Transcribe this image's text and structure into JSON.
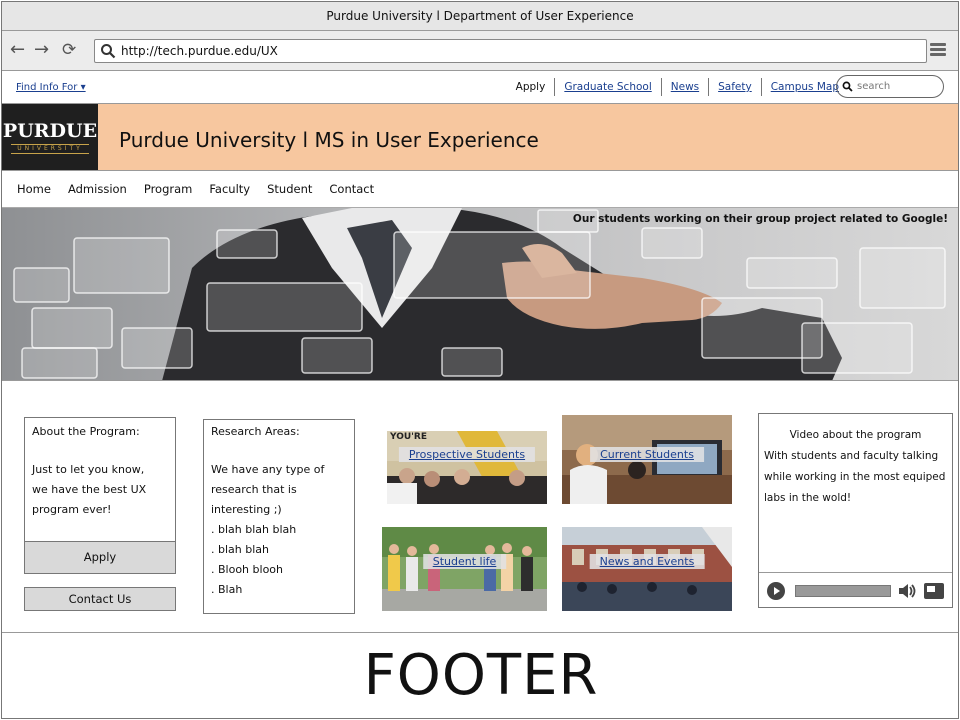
{
  "window": {
    "title": "Purdue University l Department of User Experience"
  },
  "browser": {
    "url": "http://tech.purdue.edu/UX"
  },
  "utility": {
    "find_info": "Find Info For ▾",
    "links": [
      "Apply",
      "Graduate School",
      "News",
      "Safety",
      "Campus Map"
    ],
    "search_placeholder": "search"
  },
  "header": {
    "logo_word": "PURDUE",
    "logo_sub": "UNIVERSITY",
    "title": "Purdue University l MS in User Experience"
  },
  "nav": {
    "items": [
      "Home",
      "Admission",
      "Program",
      "Faculty",
      "Student",
      "Contact"
    ]
  },
  "hero": {
    "caption": "Our students working on their group project related to Google!"
  },
  "about": {
    "heading": "About the Program:",
    "line1": "Just to let you know,",
    "line2": "we have the best UX",
    "line3": "program ever!",
    "apply": "Apply",
    "contact": "Contact Us"
  },
  "research": {
    "heading": "Research Areas:",
    "lines": [
      "We have any type of",
      "research that is",
      "interesting ;)",
      ". blah blah blah",
      ". blah blah",
      ". Blooh blooh",
      ". Blah"
    ]
  },
  "tiles": {
    "prospective": "Prospective Students",
    "current": "Current Students",
    "life": "Student life",
    "news": "News and Events",
    "tile1_sign": "YOU'RE"
  },
  "video": {
    "line1": "Video about the program",
    "line2": "With students and faculty talking",
    "line3": "while working in the most equiped",
    "line4": "labs in the wold!",
    "progress": 0.0
  },
  "footer": {
    "text": "FOOTER"
  }
}
